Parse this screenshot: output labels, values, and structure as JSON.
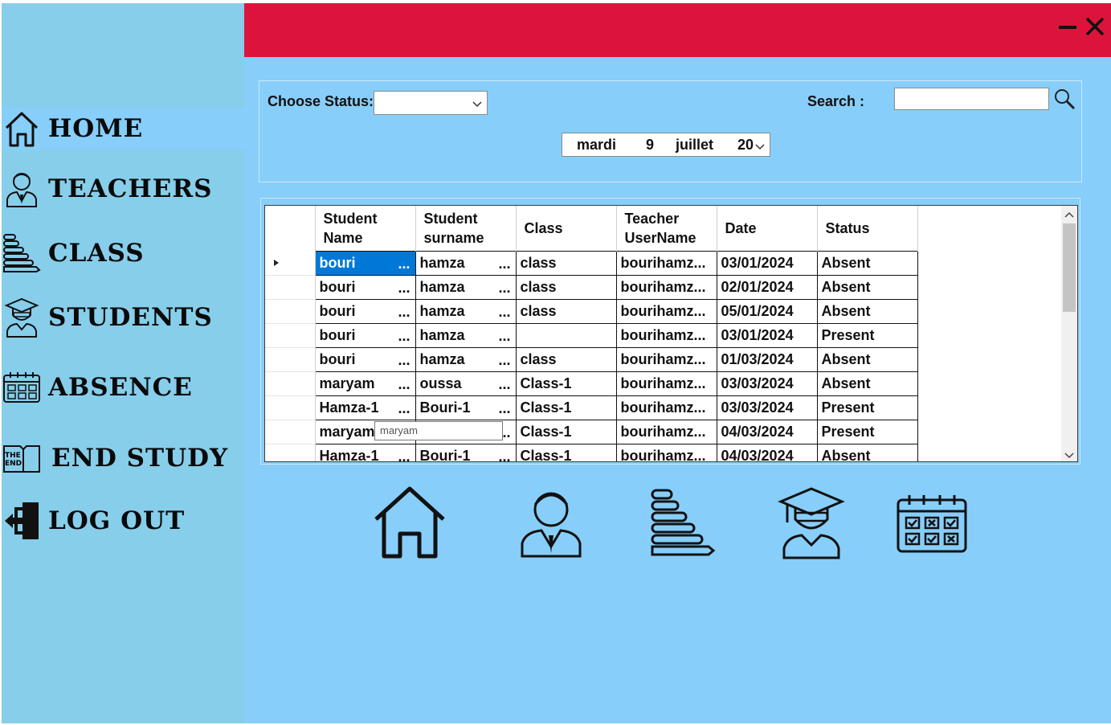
{
  "sidebar": {
    "items": [
      {
        "label": "HOME",
        "icon": "home-icon",
        "active": true
      },
      {
        "label": "TEACHERS",
        "icon": "teacher-icon"
      },
      {
        "label": "CLASS",
        "icon": "class-icon"
      },
      {
        "label": "STUDENTS",
        "icon": "student-icon"
      },
      {
        "label": "ABSENCE",
        "icon": "calendar-icon"
      },
      {
        "label": "END STUDY",
        "icon": "the-end-book-icon",
        "icon_text_top": "THE",
        "icon_text_bottom": "END"
      },
      {
        "label": "LOG OUT",
        "icon": "logout-icon"
      }
    ]
  },
  "titlebar": {
    "accent": "#dc143c",
    "minimize_icon": "minimize-icon",
    "close_icon": "close-icon"
  },
  "filters": {
    "status_label": "Choose Status:",
    "status_value": "",
    "search_label": "Search :",
    "search_value": "",
    "date": {
      "weekday": "mardi",
      "day": "9",
      "month": "juillet",
      "year": "20"
    }
  },
  "grid": {
    "columns": [
      "Student Name",
      "Student surname",
      "Class",
      "Teacher UserName",
      "Date",
      "Status"
    ],
    "column_lines": [
      [
        "Student",
        "Name"
      ],
      [
        "Student",
        "surname"
      ],
      [
        "Class"
      ],
      [
        "Teacher",
        "UserName"
      ],
      [
        "Date"
      ],
      [
        "Status"
      ]
    ],
    "rows": [
      {
        "name": "bouri",
        "surname": "hamza",
        "class": "class",
        "teacher": "bourihamz...",
        "date": "03/01/2024",
        "status": "Absent"
      },
      {
        "name": "bouri",
        "surname": "hamza",
        "class": "class",
        "teacher": "bourihamz...",
        "date": "02/01/2024",
        "status": "Absent"
      },
      {
        "name": "bouri",
        "surname": "hamza",
        "class": "class",
        "teacher": "bourihamz...",
        "date": "05/01/2024",
        "status": "Absent"
      },
      {
        "name": "bouri",
        "surname": "hamza",
        "class": "",
        "teacher": "bourihamz...",
        "date": "03/01/2024",
        "status": "Present"
      },
      {
        "name": "bouri",
        "surname": "hamza",
        "class": "class",
        "teacher": "bourihamz...",
        "date": "01/03/2024",
        "status": "Absent"
      },
      {
        "name": "maryam",
        "surname": "oussa",
        "class": "Class-1",
        "teacher": "bourihamz...",
        "date": "03/03/2024",
        "status": "Absent"
      },
      {
        "name": "Hamza-1",
        "surname": "Bouri-1",
        "class": "Class-1",
        "teacher": "bourihamz...",
        "date": "03/03/2024",
        "status": "Present"
      },
      {
        "name": "maryam",
        "surname": "",
        "class": "Class-1",
        "teacher": "bourihamz...",
        "date": "04/03/2024",
        "status": "Present"
      },
      {
        "name": "Hamza-1",
        "surname": "Bouri-1",
        "class": "Class-1",
        "teacher": "bourihamz...",
        "date": "04/03/2024",
        "status": "Absent"
      }
    ],
    "ellipsis": "...",
    "tooltip": "maryam"
  },
  "quick_icons": [
    "home-icon",
    "teacher-icon",
    "class-icon",
    "student-icon",
    "calendar-icon"
  ]
}
